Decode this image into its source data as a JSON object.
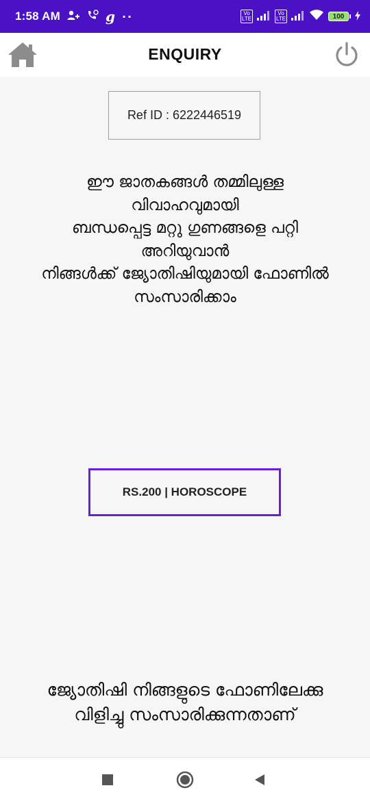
{
  "status_bar": {
    "time": "1:58 AM",
    "notification_icons": [
      "contacts-icon",
      "call-icon",
      "g-icon",
      "more-dots-icon"
    ],
    "g_glyph": "g",
    "dots_glyph": "··",
    "volte_label": "Vo\nLTE",
    "battery_level": "100",
    "bg_color": "#4a12c4"
  },
  "app_bar": {
    "title": "ENQUIRY",
    "home_icon": "home-icon",
    "power_icon": "power-icon"
  },
  "ref": {
    "text": "Ref ID : 6222446519"
  },
  "info": {
    "lines": [
      "ഈ ജാതകങ്ങൾ തമ്മിലുള്ള",
      "വിവാഹവുമായി",
      "ബന്ധപ്പെട്ട മറ്റു ഗുണങ്ങളെ പറ്റി",
      "അറിയുവാൻ",
      "നിങ്ങൾക്ക് ജ്യോതിഷിയുമായി ഫോണിൽ",
      "സംസാരിക്കാം"
    ]
  },
  "horoscope_button": {
    "label": "RS.200 | HOROSCOPE",
    "border_color": "#6a1fd6"
  },
  "bottom": {
    "lines": [
      "ജ്യോതിഷി നിങ്ങളുടെ ഫോണിലേക്കു",
      "വിളിച്ചു സംസാരിക്കുന്നതാണ്"
    ]
  },
  "nav_bar": {
    "icons": [
      "recents-square-icon",
      "home-circle-icon",
      "back-triangle-icon"
    ]
  }
}
